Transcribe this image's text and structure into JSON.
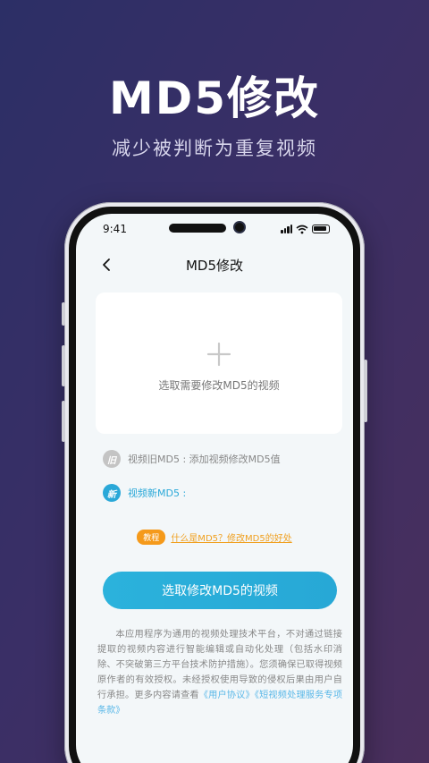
{
  "hero": {
    "title": "MD5修改",
    "subtitle": "减少被判断为重复视频"
  },
  "status_bar": {
    "time": "9:41"
  },
  "nav": {
    "title": "MD5修改",
    "back_icon": "chevron-left-icon"
  },
  "picker": {
    "icon": "plus-icon",
    "label": "选取需要修改MD5的视频"
  },
  "old_md5": {
    "badge": "旧",
    "badge_color": "#c4c4c4",
    "label": "视频旧MD5 : 添加视频修改MD5值"
  },
  "new_md5": {
    "badge": "新",
    "badge_color": "#2aa8d8",
    "label": "视频新MD5 :"
  },
  "tutorial": {
    "badge": "教程",
    "link": "什么是MD5？修改MD5的好处"
  },
  "primary_button": {
    "label": "选取修改MD5的视频"
  },
  "disclaimer": {
    "text": "本应用程序为通用的视频处理技术平台，不对通过链接提取的视频内容进行智能编辑或自动化处理（包括水印消除、不突破第三方平台技术防护措施）。您须确保已取得视频原作者的有效授权。未经授权使用导致的侵权后果由用户自行承担。更多内容请查看",
    "link_user_agreement": "《用户协议》",
    "link_service_terms": "《短视频处理服务专项条款》"
  },
  "colors": {
    "accent": "#2bb2dc",
    "tutorial_orange": "#f59a1b",
    "link_blue": "#5ab8e8"
  }
}
